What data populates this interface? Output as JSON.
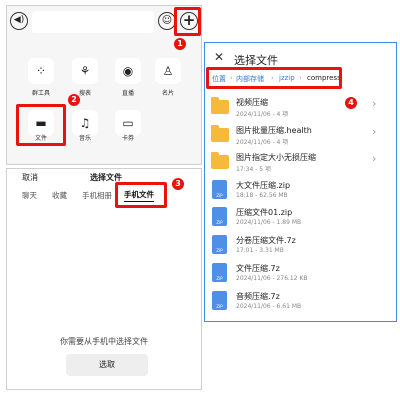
{
  "chat": {
    "voice_icon": "voice-icon",
    "emoji_icon": "emoji-icon",
    "plus_icon": "plus-icon",
    "tiles": [
      {
        "icon": "grid-icon",
        "label": "群工具"
      },
      {
        "icon": "ring-icon",
        "label": "搜表"
      },
      {
        "icon": "record-icon",
        "label": "直播"
      },
      {
        "icon": "person-icon",
        "label": "名片"
      },
      {
        "icon": "folder-icon",
        "label": "文件"
      },
      {
        "icon": "music-icon",
        "label": "音乐"
      },
      {
        "icon": "card-icon",
        "label": "卡券"
      }
    ]
  },
  "sheet": {
    "cancel_label": "取消",
    "title": "选择文件",
    "tabs": [
      "聊天",
      "收藏",
      "手机相册",
      "手机文件"
    ],
    "active_tab": "手机文件",
    "empty_message": "你需要从手机中选择文件",
    "select_label": "选取"
  },
  "browser": {
    "title": "选择文件",
    "breadcrumb": [
      "位置",
      "内部存储",
      "jzzip",
      "compress"
    ],
    "rows": [
      {
        "type": "folder",
        "name": "视频压缩",
        "meta": "2024/11/06 - 4 项",
        "chevron": true
      },
      {
        "type": "folder",
        "name": "图片批量压缩.health",
        "meta": "2024/11/06 - 4 项",
        "chevron": true
      },
      {
        "type": "folder",
        "name": "图片指定大小无损压缩",
        "meta": "17:34 - 5 项",
        "chevron": true
      },
      {
        "type": "zip",
        "name": "大文件压缩.zip",
        "meta": "18:18 - 62.56 MB",
        "chevron": false
      },
      {
        "type": "zip",
        "name": "压缩文件01.zip",
        "meta": "2024/11/06 - 1.89 MB",
        "chevron": false
      },
      {
        "type": "zip",
        "name": "分卷压缩文件.7z",
        "meta": "17:01 - 3.31 MB",
        "chevron": false
      },
      {
        "type": "zip",
        "name": "文件压缩.7z",
        "meta": "2024/11/06 - 276.12 KB",
        "chevron": false
      },
      {
        "type": "zip",
        "name": "音频压缩.7z",
        "meta": "2024/11/06 - 6.61 MB",
        "chevron": false
      }
    ]
  },
  "steps": [
    "1",
    "2",
    "3",
    "4"
  ],
  "colors": {
    "highlight": "#e8120e",
    "accent": "#2f7be0",
    "folder": "#f6b93b"
  }
}
